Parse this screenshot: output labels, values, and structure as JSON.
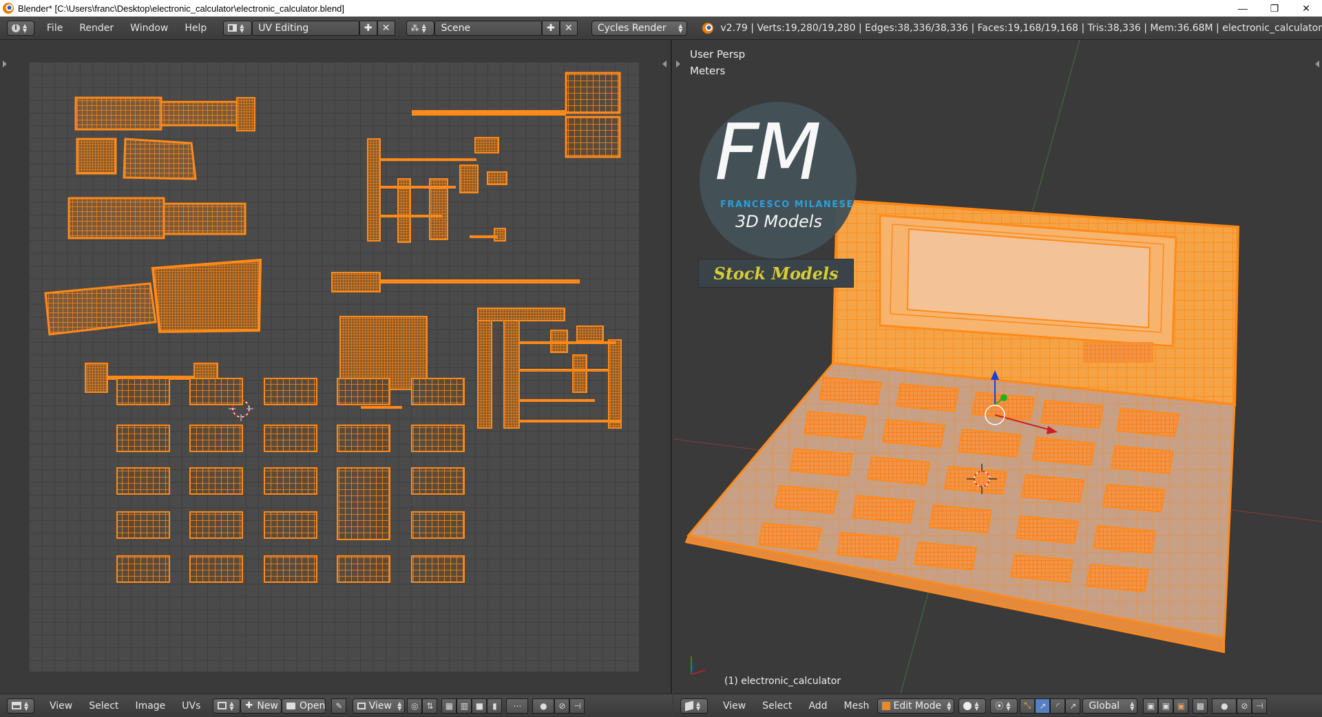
{
  "window": {
    "title": "Blender* [C:\\Users\\franc\\Desktop\\electronic_calculator\\electronic_calculator.blend]",
    "minimize": "—",
    "restore": "❐",
    "close": "✕"
  },
  "info_header": {
    "menus": [
      "File",
      "Render",
      "Window",
      "Help"
    ],
    "screen_layout": "UV Editing",
    "scene": "Scene",
    "render_engine": "Cycles Render",
    "stats": "v2.79 | Verts:19,280/19,280 | Edges:38,336/38,336 | Faces:19,168/19,168 | Tris:38,336 | Mem:36.68M | electronic_calculator"
  },
  "view3d": {
    "view_name": "User Persp",
    "units": "Meters",
    "object_label": "(1) electronic_calculator",
    "watermark": {
      "monogram": "FM",
      "author": "FRANCESCO MILANESE",
      "subtitle": "3D Models",
      "banner": "Stock Models"
    }
  },
  "uv_footer": {
    "menus": [
      "View",
      "Select",
      "Image",
      "UVs"
    ],
    "new_label": "New",
    "open_label": "Open",
    "view_label": "View"
  },
  "v3d_footer": {
    "menus": [
      "View",
      "Select",
      "Add",
      "Mesh"
    ],
    "mode": "Edit Mode",
    "orientation": "Global"
  },
  "colors": {
    "wire": "#ff8a1a",
    "wire_dark": "#8a5a2a",
    "accent_blue": "#2aa5e0",
    "banner_text": "#d6cc3a"
  },
  "icons": [
    "blender-logo-icon",
    "info-editor-icon",
    "screen-layout-icon",
    "scene-icon",
    "add-icon",
    "remove-icon",
    "image-editor-icon",
    "view3d-editor-icon",
    "pivot-icon",
    "snap-icon",
    "transform-manipulator-icon"
  ]
}
